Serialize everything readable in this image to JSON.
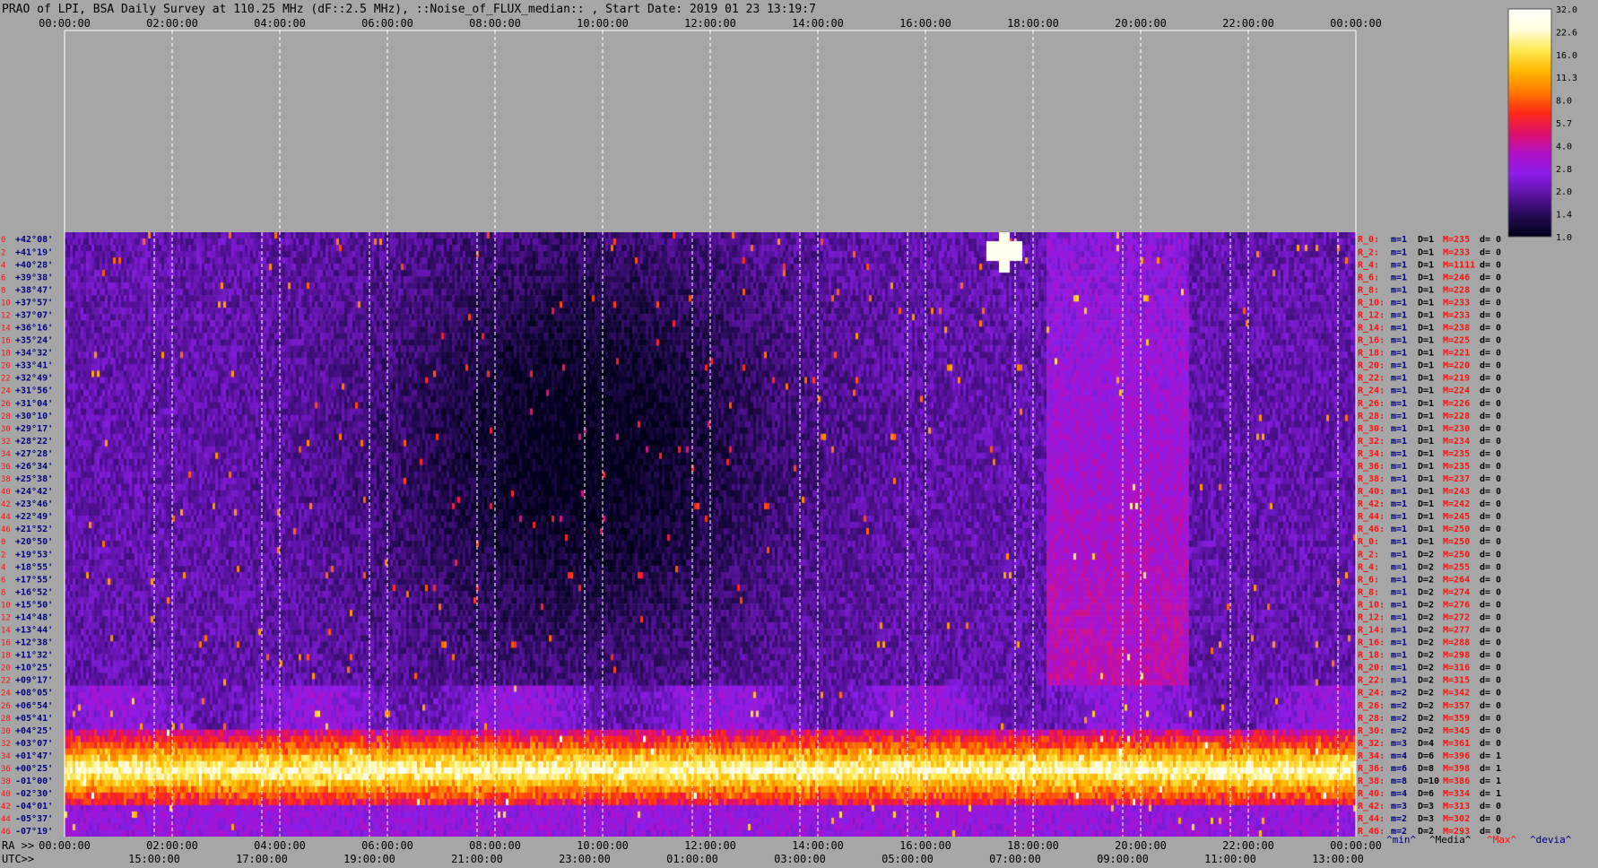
{
  "chart_data": {
    "type": "heatmap",
    "title": "PRAO of LPI, BSA Daily Survey at 110.25 MHz (dF::2.5 MHz), ::Noise_of_FLUX_median:: , Start Date: 2019 01 23 13:19:7",
    "top_ticks": [
      "00:00:00",
      "02:00:00",
      "04:00:00",
      "06:00:00",
      "08:00:00",
      "10:00:00",
      "12:00:00",
      "14:00:00",
      "16:00:00",
      "18:00:00",
      "20:00:00",
      "22:00:00",
      "00:00:00"
    ],
    "bottom_ra_label": "RA >>",
    "bottom_ra_ticks": [
      "00:00:00",
      "02:00:00",
      "04:00:00",
      "06:00:00",
      "08:00:00",
      "10:00:00",
      "12:00:00",
      "14:00:00",
      "16:00:00",
      "18:00:00",
      "20:00:00",
      "22:00:00",
      "00:00:00"
    ],
    "bottom_utc_label": "UTC>>",
    "bottom_utc_ticks": [
      "15:00:00",
      "17:00:00",
      "19:00:00",
      "21:00:00",
      "23:00:00",
      "01:00:00",
      "03:00:00",
      "05:00:00",
      "07:00:00",
      "09:00:00",
      "11:00:00",
      "13:00:00"
    ],
    "colorbar_ticks": [
      "32.0",
      "22.6",
      "16.0",
      "11.3",
      "8.0",
      "5.7",
      "4.0",
      "2.8",
      "2.0",
      "1.4",
      "1.0"
    ],
    "colorbar_colors": [
      "#000018",
      "#240a52",
      "#5a12a0",
      "#8a1ee8",
      "#b010c8",
      "#e0106a",
      "#ff2a14",
      "#ff7a00",
      "#ffb800",
      "#ffe850",
      "#ffffe0",
      "#ffffff"
    ],
    "row_numbers": [
      "0",
      "2",
      "4",
      "6",
      "8",
      "10",
      "12",
      "14",
      "16",
      "18",
      "20",
      "22",
      "24",
      "26",
      "28",
      "30",
      "32",
      "34",
      "36",
      "38",
      "40",
      "42",
      "44",
      "46",
      "0",
      "2",
      "4",
      "6",
      "8",
      "10",
      "12",
      "14",
      "16",
      "18",
      "20",
      "22",
      "24",
      "26",
      "28",
      "30",
      "32",
      "34",
      "36",
      "38",
      "40",
      "42",
      "44",
      "46"
    ],
    "declinations": [
      "+42°08'",
      "+41°19'",
      "+40°28'",
      "+39°38'",
      "+38°47'",
      "+37°57'",
      "+37°07'",
      "+36°16'",
      "+35°24'",
      "+34°32'",
      "+33°41'",
      "+32°49'",
      "+31°56'",
      "+31°04'",
      "+30°10'",
      "+29°17'",
      "+28°22'",
      "+27°28'",
      "+26°34'",
      "+25°38'",
      "+24°42'",
      "+23°46'",
      "+22°49'",
      "+21°52'",
      "+20°50'",
      "+19°53'",
      "+18°55'",
      "+17°55'",
      "+16°52'",
      "+15°50'",
      "+14°48'",
      "+13°44'",
      "+12°38'",
      "+11°32'",
      "+10°25'",
      "+09°17'",
      "+08°05'",
      "+06°54'",
      "+05°41'",
      "+04°25'",
      "+03°07'",
      "+01°47'",
      "+00°25'",
      "-01°00'",
      "-02°30'",
      "-04°01'",
      "-05°37'",
      "-07°19'"
    ],
    "right_rows": [
      {
        "r": "R_0:",
        "m": "m=1",
        "d": "D=1",
        "M": "M=235",
        "dev": "d= 0"
      },
      {
        "r": "R_2:",
        "m": "m=1",
        "d": "D=1",
        "M": "M=233",
        "dev": "d= 0"
      },
      {
        "r": "R_4:",
        "m": "m=1",
        "d": "D=1",
        "M": "M=1111",
        "dev": "d= 0"
      },
      {
        "r": "R_6:",
        "m": "m=1",
        "d": "D=1",
        "M": "M=246",
        "dev": "d= 0"
      },
      {
        "r": "R_8:",
        "m": "m=1",
        "d": "D=1",
        "M": "M=228",
        "dev": "d= 0"
      },
      {
        "r": "R_10:",
        "m": "m=1",
        "d": "D=1",
        "M": "M=233",
        "dev": "d= 0"
      },
      {
        "r": "R_12:",
        "m": "m=1",
        "d": "D=1",
        "M": "M=233",
        "dev": "d= 0"
      },
      {
        "r": "R_14:",
        "m": "m=1",
        "d": "D=1",
        "M": "M=238",
        "dev": "d= 0"
      },
      {
        "r": "R_16:",
        "m": "m=1",
        "d": "D=1",
        "M": "M=225",
        "dev": "d= 0"
      },
      {
        "r": "R_18:",
        "m": "m=1",
        "d": "D=1",
        "M": "M=221",
        "dev": "d= 0"
      },
      {
        "r": "R_20:",
        "m": "m=1",
        "d": "D=1",
        "M": "M=220",
        "dev": "d= 0"
      },
      {
        "r": "R_22:",
        "m": "m=1",
        "d": "D=1",
        "M": "M=219",
        "dev": "d= 0"
      },
      {
        "r": "R_24:",
        "m": "m=1",
        "d": "D=1",
        "M": "M=224",
        "dev": "d= 0"
      },
      {
        "r": "R_26:",
        "m": "m=1",
        "d": "D=1",
        "M": "M=226",
        "dev": "d= 0"
      },
      {
        "r": "R_28:",
        "m": "m=1",
        "d": "D=1",
        "M": "M=228",
        "dev": "d= 0"
      },
      {
        "r": "R_30:",
        "m": "m=1",
        "d": "D=1",
        "M": "M=230",
        "dev": "d= 0"
      },
      {
        "r": "R_32:",
        "m": "m=1",
        "d": "D=1",
        "M": "M=234",
        "dev": "d= 0"
      },
      {
        "r": "R_34:",
        "m": "m=1",
        "d": "D=1",
        "M": "M=235",
        "dev": "d= 0"
      },
      {
        "r": "R_36:",
        "m": "m=1",
        "d": "D=1",
        "M": "M=235",
        "dev": "d= 0"
      },
      {
        "r": "R_38:",
        "m": "m=1",
        "d": "D=1",
        "M": "M=237",
        "dev": "d= 0"
      },
      {
        "r": "R_40:",
        "m": "m=1",
        "d": "D=1",
        "M": "M=243",
        "dev": "d= 0"
      },
      {
        "r": "R_42:",
        "m": "m=1",
        "d": "D=1",
        "M": "M=242",
        "dev": "d= 0"
      },
      {
        "r": "R_44:",
        "m": "m=1",
        "d": "D=1",
        "M": "M=245",
        "dev": "d= 0"
      },
      {
        "r": "R_46:",
        "m": "m=1",
        "d": "D=1",
        "M": "M=250",
        "dev": "d= 0"
      },
      {
        "r": "R_0:",
        "m": "m=1",
        "d": "D=1",
        "M": "M=250",
        "dev": "d= 0"
      },
      {
        "r": "R_2:",
        "m": "m=1",
        "d": "D=2",
        "M": "M=250",
        "dev": "d= 0"
      },
      {
        "r": "R_4:",
        "m": "m=1",
        "d": "D=2",
        "M": "M=255",
        "dev": "d= 0"
      },
      {
        "r": "R_6:",
        "m": "m=1",
        "d": "D=2",
        "M": "M=264",
        "dev": "d= 0"
      },
      {
        "r": "R_8:",
        "m": "m=1",
        "d": "D=2",
        "M": "M=274",
        "dev": "d= 0"
      },
      {
        "r": "R_10:",
        "m": "m=1",
        "d": "D=2",
        "M": "M=276",
        "dev": "d= 0"
      },
      {
        "r": "R_12:",
        "m": "m=1",
        "d": "D=2",
        "M": "M=272",
        "dev": "d= 0"
      },
      {
        "r": "R_14:",
        "m": "m=1",
        "d": "D=2",
        "M": "M=277",
        "dev": "d= 0"
      },
      {
        "r": "R_16:",
        "m": "m=1",
        "d": "D=2",
        "M": "M=288",
        "dev": "d= 0"
      },
      {
        "r": "R_18:",
        "m": "m=1",
        "d": "D=2",
        "M": "M=298",
        "dev": "d= 0"
      },
      {
        "r": "R_20:",
        "m": "m=1",
        "d": "D=2",
        "M": "M=316",
        "dev": "d= 0"
      },
      {
        "r": "R_22:",
        "m": "m=1",
        "d": "D=2",
        "M": "M=315",
        "dev": "d= 0"
      },
      {
        "r": "R_24:",
        "m": "m=2",
        "d": "D=2",
        "M": "M=342",
        "dev": "d= 0"
      },
      {
        "r": "R_26:",
        "m": "m=2",
        "d": "D=2",
        "M": "M=357",
        "dev": "d= 0"
      },
      {
        "r": "R_28:",
        "m": "m=2",
        "d": "D=2",
        "M": "M=359",
        "dev": "d= 0"
      },
      {
        "r": "R_30:",
        "m": "m=2",
        "d": "D=2",
        "M": "M=345",
        "dev": "d= 0"
      },
      {
        "r": "R_32:",
        "m": "m=3",
        "d": "D=4",
        "M": "M=361",
        "dev": "d= 0"
      },
      {
        "r": "R_34:",
        "m": "m=4",
        "d": "D=6",
        "M": "M=396",
        "dev": "d= 1"
      },
      {
        "r": "R_36:",
        "m": "m=6",
        "d": "D=8",
        "M": "M=398",
        "dev": "d= 1"
      },
      {
        "r": "R_38:",
        "m": "m=8",
        "d": "D=10",
        "M": "M=386",
        "dev": "d= 1"
      },
      {
        "r": "R_40:",
        "m": "m=4",
        "d": "D=6",
        "M": "M=334",
        "dev": "d= 1"
      },
      {
        "r": "R_42:",
        "m": "m=3",
        "d": "D=3",
        "M": "M=313",
        "dev": "d= 0"
      },
      {
        "r": "R_44:",
        "m": "m=2",
        "d": "D=3",
        "M": "M=302",
        "dev": "d= 0"
      },
      {
        "r": "R_46:",
        "m": "m=2",
        "d": "D=2",
        "M": "M=293",
        "dev": "d= 0"
      }
    ],
    "legend_row": [
      "^min^",
      "^Media^",
      "^Max^",
      "^devia^"
    ],
    "colors": {
      "row_num": "#ff1010",
      "dec_label": "#000080",
      "r_label": "#ff1010",
      "m_col": "#000080",
      "d_col": "#000000",
      "M_col": "#ff1010",
      "dev_col": "#000000",
      "legend_min": "#000080",
      "legend_media": "#000000",
      "legend_max": "#ff1010",
      "legend_devia": "#000080"
    }
  }
}
